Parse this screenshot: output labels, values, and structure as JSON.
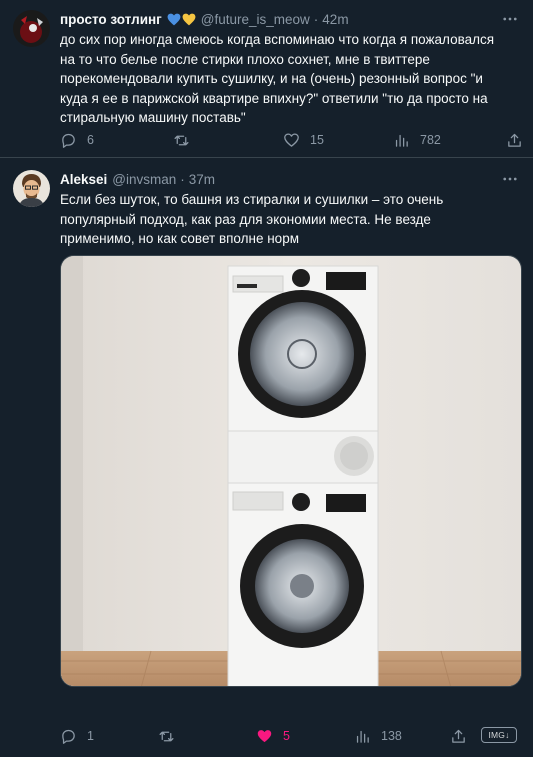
{
  "tweets": [
    {
      "display_name": "просто зотлинг",
      "handle": "@future_is_meow",
      "separator": "·",
      "time": "42m",
      "text": "до сих пор иногда смеюсь когда вспоминаю что когда я пожаловался\nна то что белье после стирки плохо сохнет, мне в твиттере\nпорекомендовали купить сушилку, и на (очень) резонный вопрос \"и\nкуда я ее в парижской квартире впихну?\" ответили \"тю да просто на\nстиральную машину поставь\"",
      "badge_colors": [
        "#4a90e2",
        "#f5c542"
      ],
      "actions": {
        "replies": "6",
        "retweets": "",
        "likes": "15",
        "views": "782"
      }
    },
    {
      "display_name": "Aleksei",
      "handle": "@invsman",
      "separator": "·",
      "time": "37m",
      "text": "Если без шуток, то башня из стиралки и сушилки – это очень\nпопулярный подход, как раз для экономии места. Не везде\nприменимо, но как совет вполне норм",
      "actions": {
        "replies": "1",
        "retweets": "",
        "likes": "5",
        "views": "138"
      },
      "media_badge": "IMG↓"
    }
  ],
  "colors": {
    "background": "#15202b",
    "text": "#f7f9f9",
    "secondary": "#8b98a5",
    "like": "#f91880",
    "divider": "#38444d"
  },
  "icons": [
    "more-icon",
    "reply-icon",
    "retweet-icon",
    "like-icon",
    "views-icon",
    "share-icon",
    "avatar",
    "verified-heart-badges"
  ]
}
